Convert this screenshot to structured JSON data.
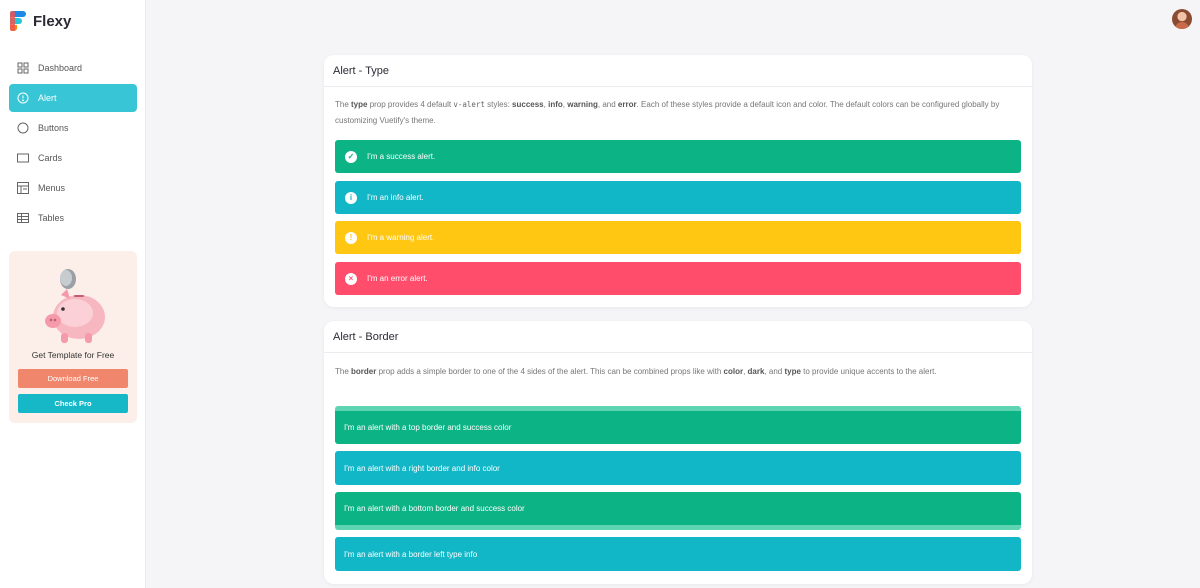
{
  "app": {
    "name": "Flexy"
  },
  "sidebar": {
    "items": [
      {
        "label": "Dashboard",
        "icon": "dashboard-icon",
        "active": false
      },
      {
        "label": "Alert",
        "icon": "info-circle-icon",
        "active": true
      },
      {
        "label": "Buttons",
        "icon": "circle-icon",
        "active": false
      },
      {
        "label": "Cards",
        "icon": "card-icon",
        "active": false
      },
      {
        "label": "Menus",
        "icon": "menu-icon",
        "active": false
      },
      {
        "label": "Tables",
        "icon": "table-icon",
        "active": false
      }
    ],
    "promo": {
      "title": "Get Template for Free",
      "download_label": "Download Free",
      "pro_label": "Check Pro"
    }
  },
  "cards": {
    "type": {
      "title": "Alert - Type",
      "desc": {
        "t1": "The ",
        "b1": "type",
        "t2": " prop provides 4 default ",
        "code": "v-alert",
        "t3": " styles: ",
        "b2": "success",
        "t4": ", ",
        "b3": "info",
        "t5": ", ",
        "b4": "warning",
        "t6": ", and ",
        "b5": "error",
        "t7": ". Each of these styles provide a default icon and color. The default colors can be configured globally by customizing Vuetify's theme."
      },
      "alerts": [
        {
          "text": "I'm a success alert.",
          "icon": "check-circle-icon"
        },
        {
          "text": "I'm an info alert.",
          "icon": "info-circle-icon"
        },
        {
          "text": "I'm a warning alert.",
          "icon": "exclamation-circle-icon"
        },
        {
          "text": "I'm an error alert.",
          "icon": "close-circle-icon"
        }
      ]
    },
    "border": {
      "title": "Alert - Border",
      "desc": {
        "t1": "The ",
        "b1": "border",
        "t2": " prop adds a simple border to one of the 4 sides of the alert. This can be combined props like with ",
        "b2": "color",
        "t3": ", ",
        "b3": "dark",
        "t4": ", and ",
        "b4": "type",
        "t5": " to provide unique accents to the alert."
      },
      "alerts": [
        {
          "text": "I'm an alert with a top border and success color"
        },
        {
          "text": "I'm an alert with a right border and info color"
        },
        {
          "text": "I'm an alert with a bottom border and success color"
        },
        {
          "text": "I'm an alert with a border left type info"
        }
      ]
    }
  },
  "colors": {
    "primary": "#38c6d6",
    "success": "#0cb385",
    "info": "#12b7c7",
    "warning": "#ffc612",
    "error": "#ff4d6b",
    "promo_button": "#f0866c"
  }
}
